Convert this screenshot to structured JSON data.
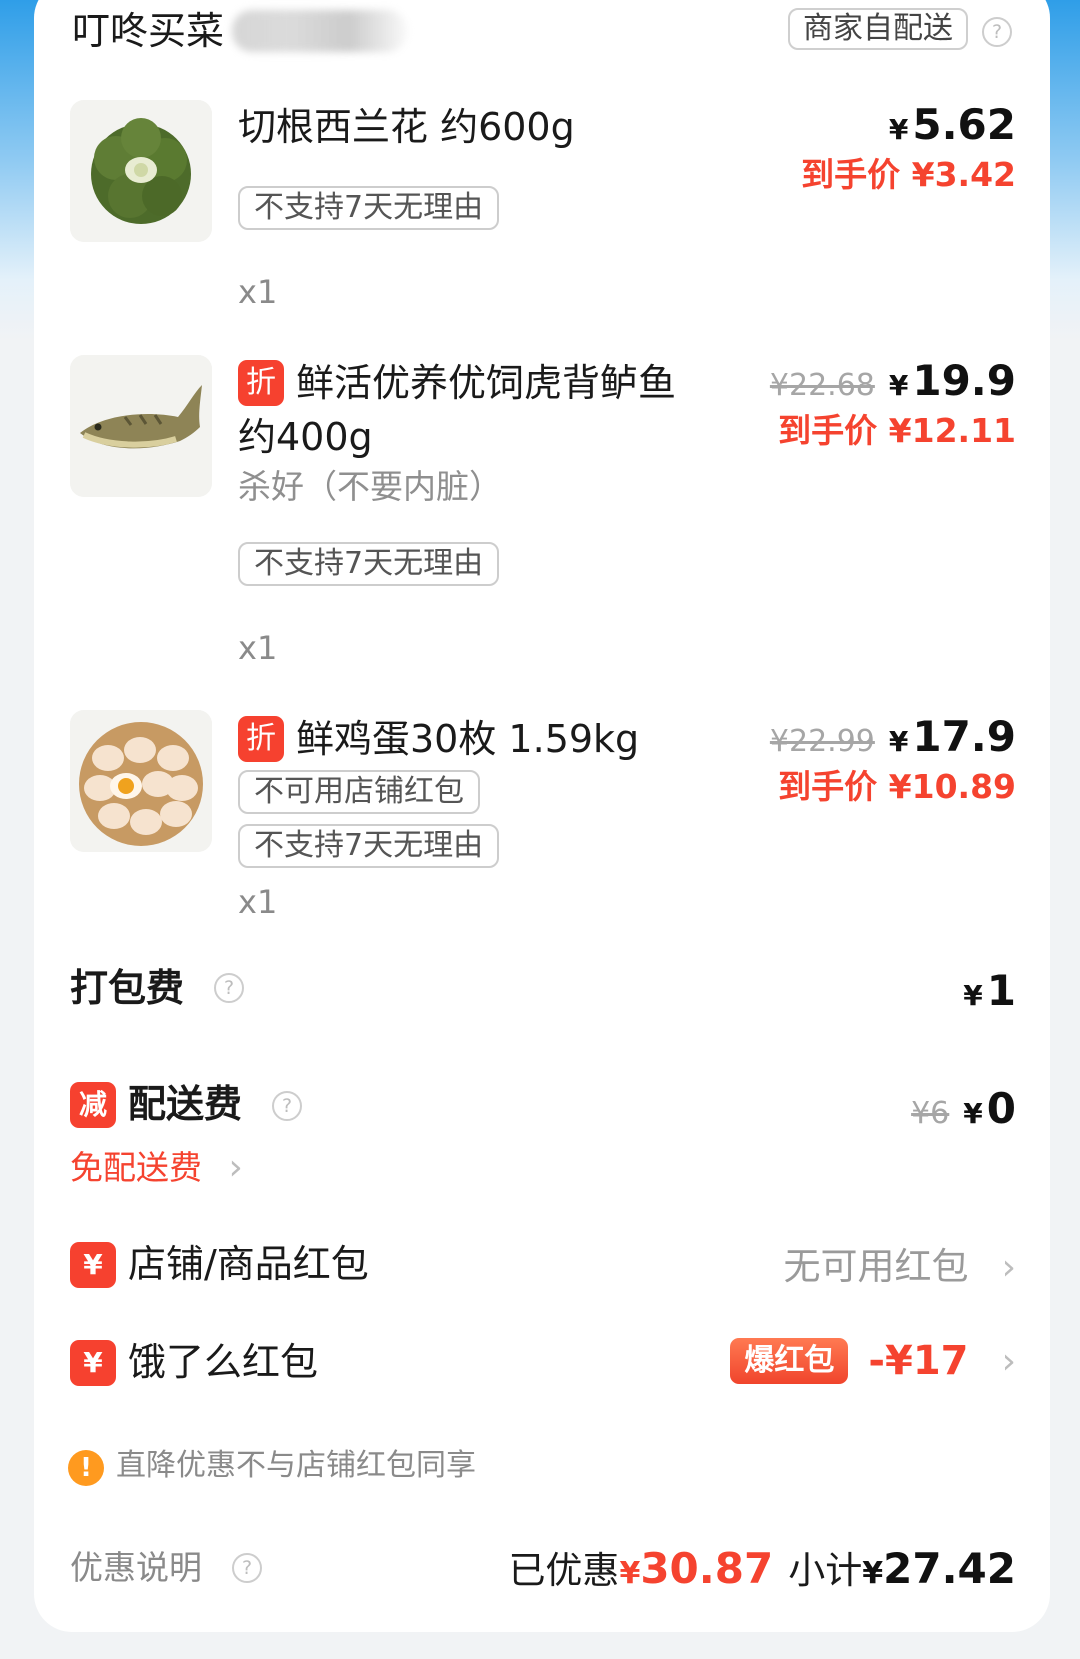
{
  "header": {
    "store_name": "叮咚买菜",
    "store_suffix_blurred": "(…)",
    "delivery_tag": "商家自配送",
    "help_glyph": "?"
  },
  "items": [
    {
      "title": "切根西兰花 约600g",
      "title_line2": "",
      "has_discount_badge": false,
      "note": "",
      "tags": [
        "不支持7天无理由"
      ],
      "qty": "x1",
      "original_price": "",
      "price": "5.62",
      "deal_label": "到手价",
      "deal_price": "¥3.42",
      "image_icon": "broccoli-image"
    },
    {
      "badge": "折",
      "title": "鲜活优养优饲虎背鲈鱼",
      "title_line2": "约400g",
      "note": "杀好（不要内脏）",
      "tags": [
        "不支持7天无理由"
      ],
      "qty": "x1",
      "original_price": "¥22.68",
      "price": "19.9",
      "deal_label": "到手价",
      "deal_price": "¥12.11",
      "image_icon": "fish-image"
    },
    {
      "badge": "折",
      "title": "鲜鸡蛋30枚 1.59kg",
      "title_line2": "",
      "note": "",
      "tags": [
        "不可用店铺红包",
        "不支持7天无理由"
      ],
      "qty": "x1",
      "original_price": "¥22.99",
      "price": "17.9",
      "deal_label": "到手价",
      "deal_price": "¥10.89",
      "image_icon": "eggs-image"
    }
  ],
  "packing_fee": {
    "label": "打包费",
    "yen": "¥",
    "value": "1"
  },
  "delivery_fee": {
    "badge": "减",
    "label": "配送费",
    "original": "¥6",
    "yen": "¥",
    "value": "0",
    "free_link": "免配送费"
  },
  "store_coupon": {
    "badge": "¥",
    "label": "店铺/商品红包",
    "value": "无可用红包"
  },
  "eleme_coupon": {
    "badge": "¥",
    "label": "饿了么红包",
    "burst": "爆红包",
    "value": "-¥17"
  },
  "notice": {
    "icon_glyph": "!",
    "text": "直降优惠不与店铺红包同享"
  },
  "footer": {
    "explain_label": "优惠说明",
    "saved_label": "已优惠",
    "saved_yen": "¥",
    "saved_value": "30.87",
    "subtotal_label": "小计",
    "subtotal_yen": "¥",
    "subtotal_value": "27.42"
  },
  "currency_symbol": "¥",
  "chevron": "›",
  "colors": {
    "accent_red": "#f5432f",
    "badge_red": "#f6412f",
    "warning_orange": "#ff9a1f"
  }
}
